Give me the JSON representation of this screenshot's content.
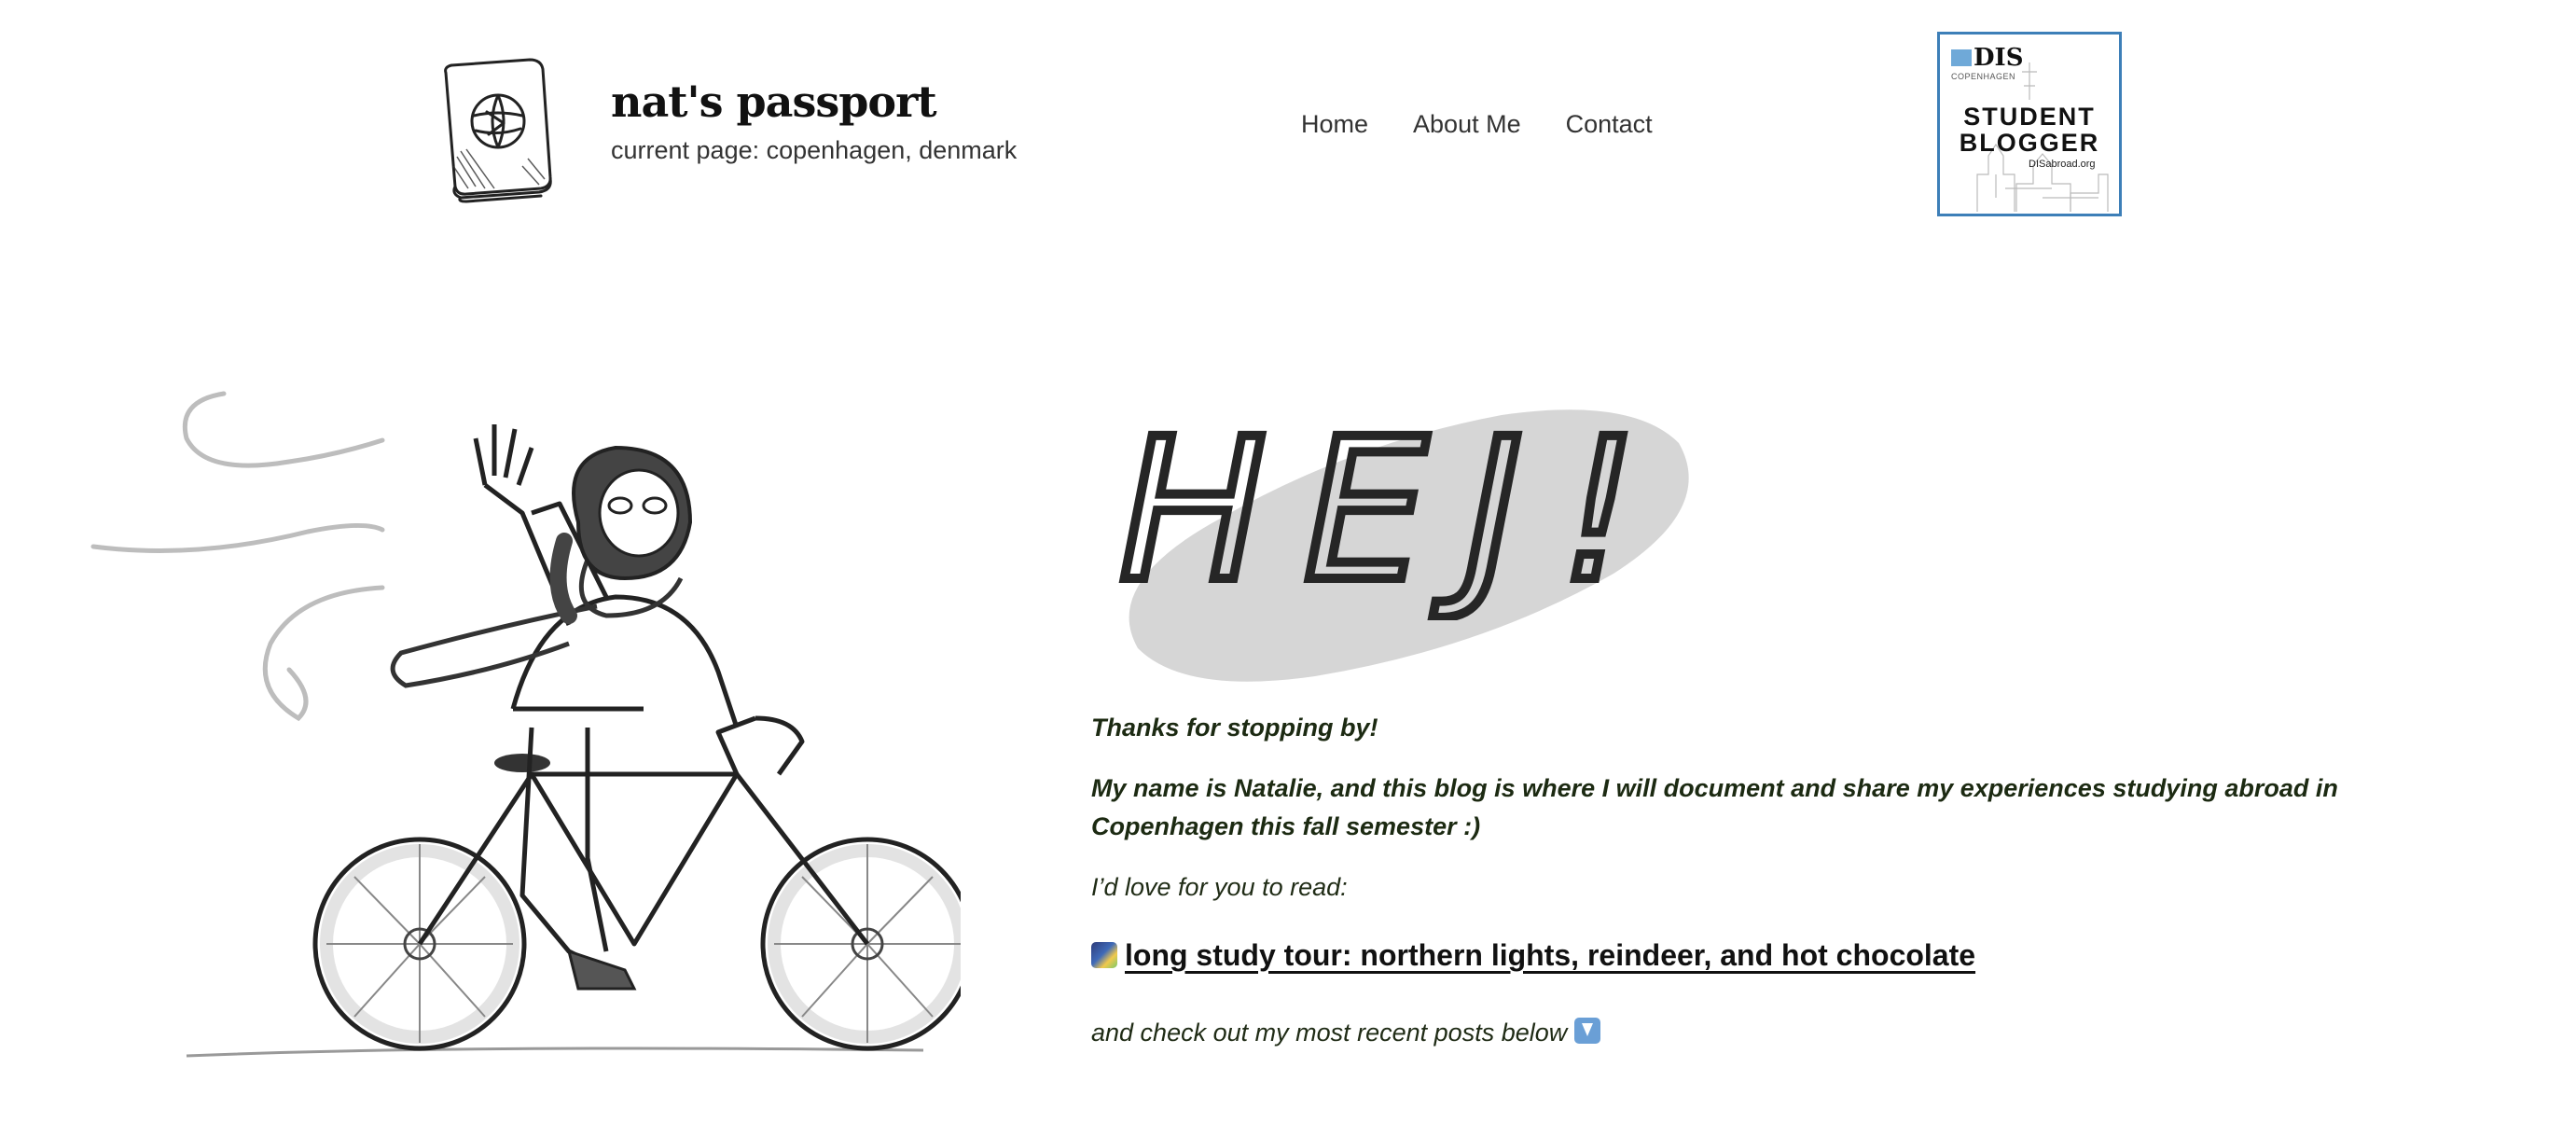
{
  "header": {
    "site_title": "nat's passport",
    "site_subtitle": "current page: copenhagen, denmark",
    "logo_icon": "passport-icon",
    "nav": [
      {
        "label": "Home"
      },
      {
        "label": "About Me"
      },
      {
        "label": "Contact"
      }
    ],
    "badge": {
      "brand": "DIS",
      "city": "COPENHAGEN",
      "line1": "STUDENT",
      "line2": "BLOGGER",
      "url": "DISabroad.org",
      "border_color": "#3d7fb8",
      "accent_color": "#6fa9d8"
    }
  },
  "hero": {
    "heading": "HEJ!",
    "illustration": "girl-on-bicycle-illustration"
  },
  "content": {
    "thanks": "Thanks for stopping by!",
    "intro": "My name is Natalie, and this blog is where I will document and share my experiences studying abroad in Copenhagen this fall semester :)",
    "read_prompt": "I’d love for you to read:",
    "featured_link": "long study tour: northern lights, reindeer, and hot chocolate",
    "featured_emoji": "northern-lights-emoji",
    "recent_text": "and check out my most recent posts below",
    "recent_emoji": "down-arrow-emoji",
    "text_color": "#1c2a12"
  }
}
